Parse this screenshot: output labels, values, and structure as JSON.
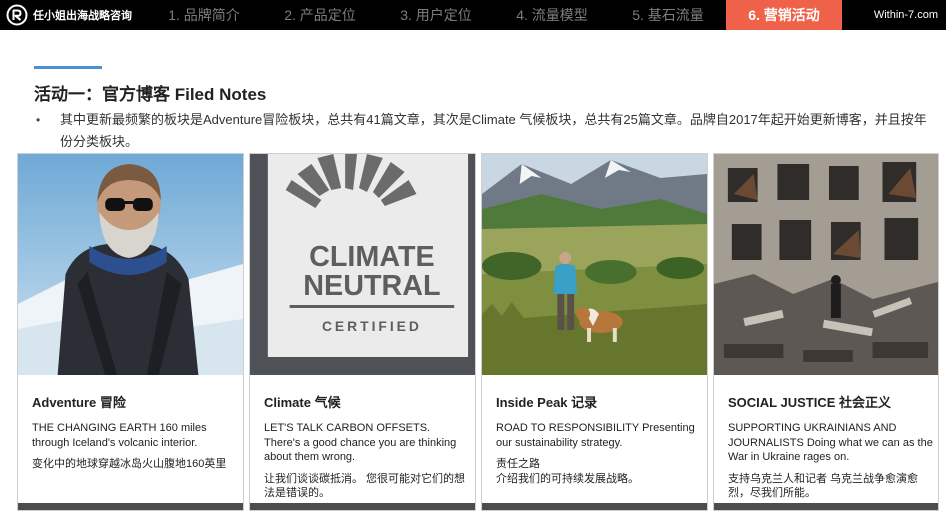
{
  "brand": {
    "name": "任小姐出海战略咨询",
    "logo_icon": "r-ring-logo-icon"
  },
  "nav": {
    "tabs": [
      {
        "label": "1. 品牌简介",
        "active": false
      },
      {
        "label": "2. 产品定位",
        "active": false
      },
      {
        "label": "3. 用户定位",
        "active": false
      },
      {
        "label": "4. 流量模型",
        "active": false
      },
      {
        "label": "5. 基石流量",
        "active": false
      },
      {
        "label": "6. 营销活动",
        "active": true
      }
    ],
    "site": "Within-7.com"
  },
  "colors": {
    "accent": "#f0614a",
    "underline": "#4a90d9",
    "topbar": "#000000",
    "card_footer": "#4d4d4d"
  },
  "section": {
    "title": "活动一：官方博客 Filed Notes",
    "bullet": "其中更新最频繁的板块是Adventure冒险板块，总共有41篇文章，其次是Climate 气候板块，总共有25篇文章。品牌自2017年起开始更新博客，并且按年份分类板块。"
  },
  "cards": [
    {
      "title": "Adventure 冒险",
      "en": "THE CHANGING EARTH 160 miles through Iceland's volcanic interior.",
      "zh": "变化中的地球穿越冰岛火山腹地160英里"
    },
    {
      "title": "Climate 气候",
      "en": "LET'S TALK CARBON OFFSETS. There's a good chance you are thinking about them wrong.",
      "zh": "让我们谈谈碳抵消。 您很可能对它们的想法是错误的。",
      "badge": {
        "line1": "CLIMATE",
        "line2": "NEUTRAL",
        "line3": "CERTIFIED"
      }
    },
    {
      "title": "Inside Peak 记录",
      "en": "ROAD TO RESPONSIBILITY Presenting our sustainability strategy.",
      "zh": "责任之路\n介绍我们的可持续发展战略。"
    },
    {
      "title": "SOCIAL JUSTICE 社会正义",
      "en": "SUPPORTING UKRAINIANS AND JOURNALISTS Doing what we can as the War in Ukraine rages on.",
      "zh": "支持乌克兰人和记者 乌克兰战争愈演愈烈，尽我们所能。"
    }
  ]
}
